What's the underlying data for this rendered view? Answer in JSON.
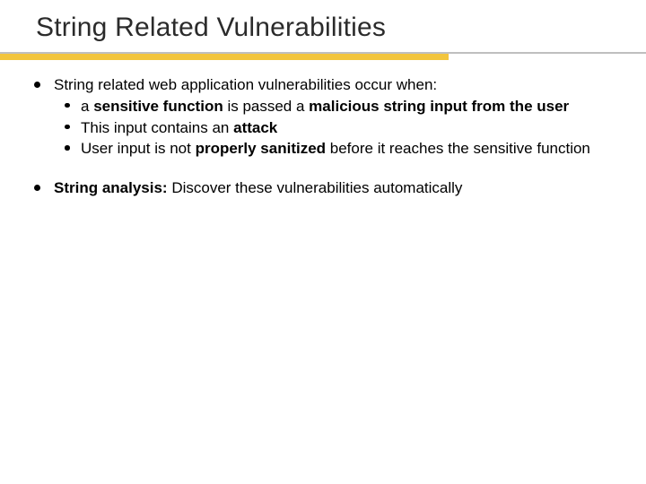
{
  "title": "String Related Vulnerabilities",
  "bullet1": {
    "lead": "String related web application vulnerabilities occur when:",
    "sub1": {
      "pre": "a ",
      "b1": "sensitive function",
      "mid": " is passed a ",
      "b2": "malicious string input from the user"
    },
    "sub2": {
      "pre": "This input contains an ",
      "b1": "attack"
    },
    "sub3": {
      "pre": "User input is not ",
      "b1": "properly sanitized",
      "post": "  before it reaches the sensitive function"
    }
  },
  "bullet2": {
    "b1": "String analysis:",
    "post": " Discover these vulnerabilities automatically"
  }
}
